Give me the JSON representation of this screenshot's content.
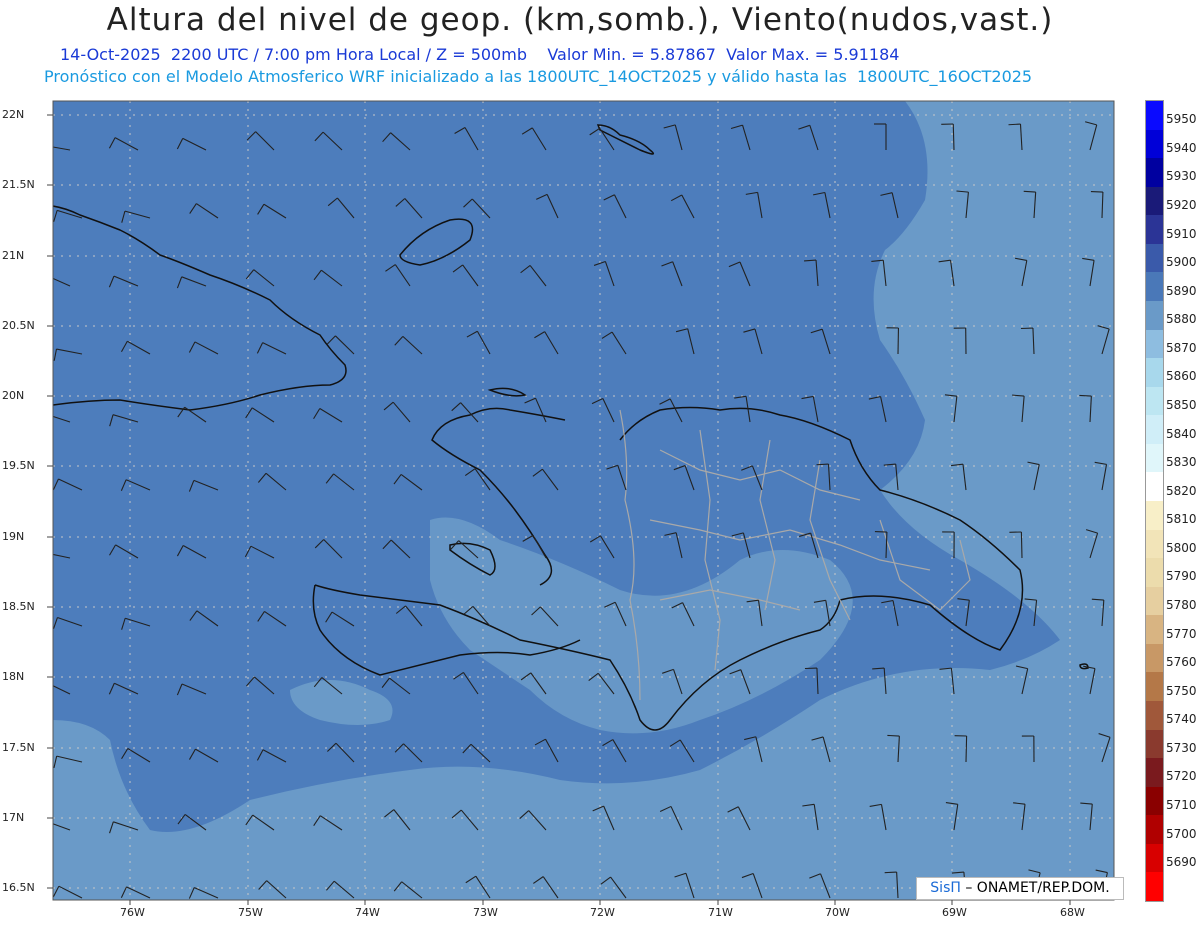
{
  "header": {
    "title": "Altura del nivel de geop. (km,somb.), Viento(nudos,vast.)",
    "line1": "14-Oct-2025  2200 UTC / 7:00 pm Hora Local / Z = 500mb    Valor Min. = 5.87867  Valor Max. = 5.91184",
    "line2": "Pronóstico con el Modelo Atmosferico WRF inicializado a las 1800UTC_14OCT2025 y válido hasta las  1800UTC_16OCT2025"
  },
  "axes": {
    "lat_labels": [
      "22N",
      "21.5N",
      "21N",
      "20.5N",
      "20N",
      "19.5N",
      "19N",
      "18.5N",
      "18N",
      "17.5N",
      "17N",
      "16.5N"
    ],
    "lon_labels": [
      "76W",
      "75W",
      "74W",
      "73W",
      "72W",
      "71W",
      "70W",
      "69W",
      "68W"
    ]
  },
  "colorbar": {
    "labels": [
      "5950",
      "5940",
      "5930",
      "5920",
      "5910",
      "5900",
      "5890",
      "5880",
      "5870",
      "5860",
      "5850",
      "5840",
      "5830",
      "5820",
      "5810",
      "5800",
      "5790",
      "5780",
      "5770",
      "5760",
      "5750",
      "5740",
      "5730",
      "5720",
      "5710",
      "5700",
      "5690"
    ],
    "colors": [
      "#0a0aff",
      "#0000d8",
      "#0000a0",
      "#1a1a78",
      "#2b3496",
      "#3a5aaa",
      "#4a78b8",
      "#6a9ac8",
      "#8ebde0",
      "#a8d8ec",
      "#bde6f2",
      "#d0eef8",
      "#e0f6fa",
      "#ffffff",
      "#f8efc8",
      "#f2e4b8",
      "#ecdcac",
      "#e6cfa0",
      "#d8b482",
      "#c89866",
      "#b47848",
      "#a0583a",
      "#8a3a2e",
      "#7a1a1e",
      "#8a0000",
      "#b00000",
      "#d80000",
      "#ff0000"
    ]
  },
  "map": {
    "background_color": "#4d7dbc",
    "light_region_color": "#6a9ac8",
    "coast_color": "#111111",
    "province_color": "#a9a9a9",
    "barb_color": "#222222"
  },
  "credit": {
    "brand": "SisΠ",
    "text": "– ONAMET/REP.DOM."
  }
}
